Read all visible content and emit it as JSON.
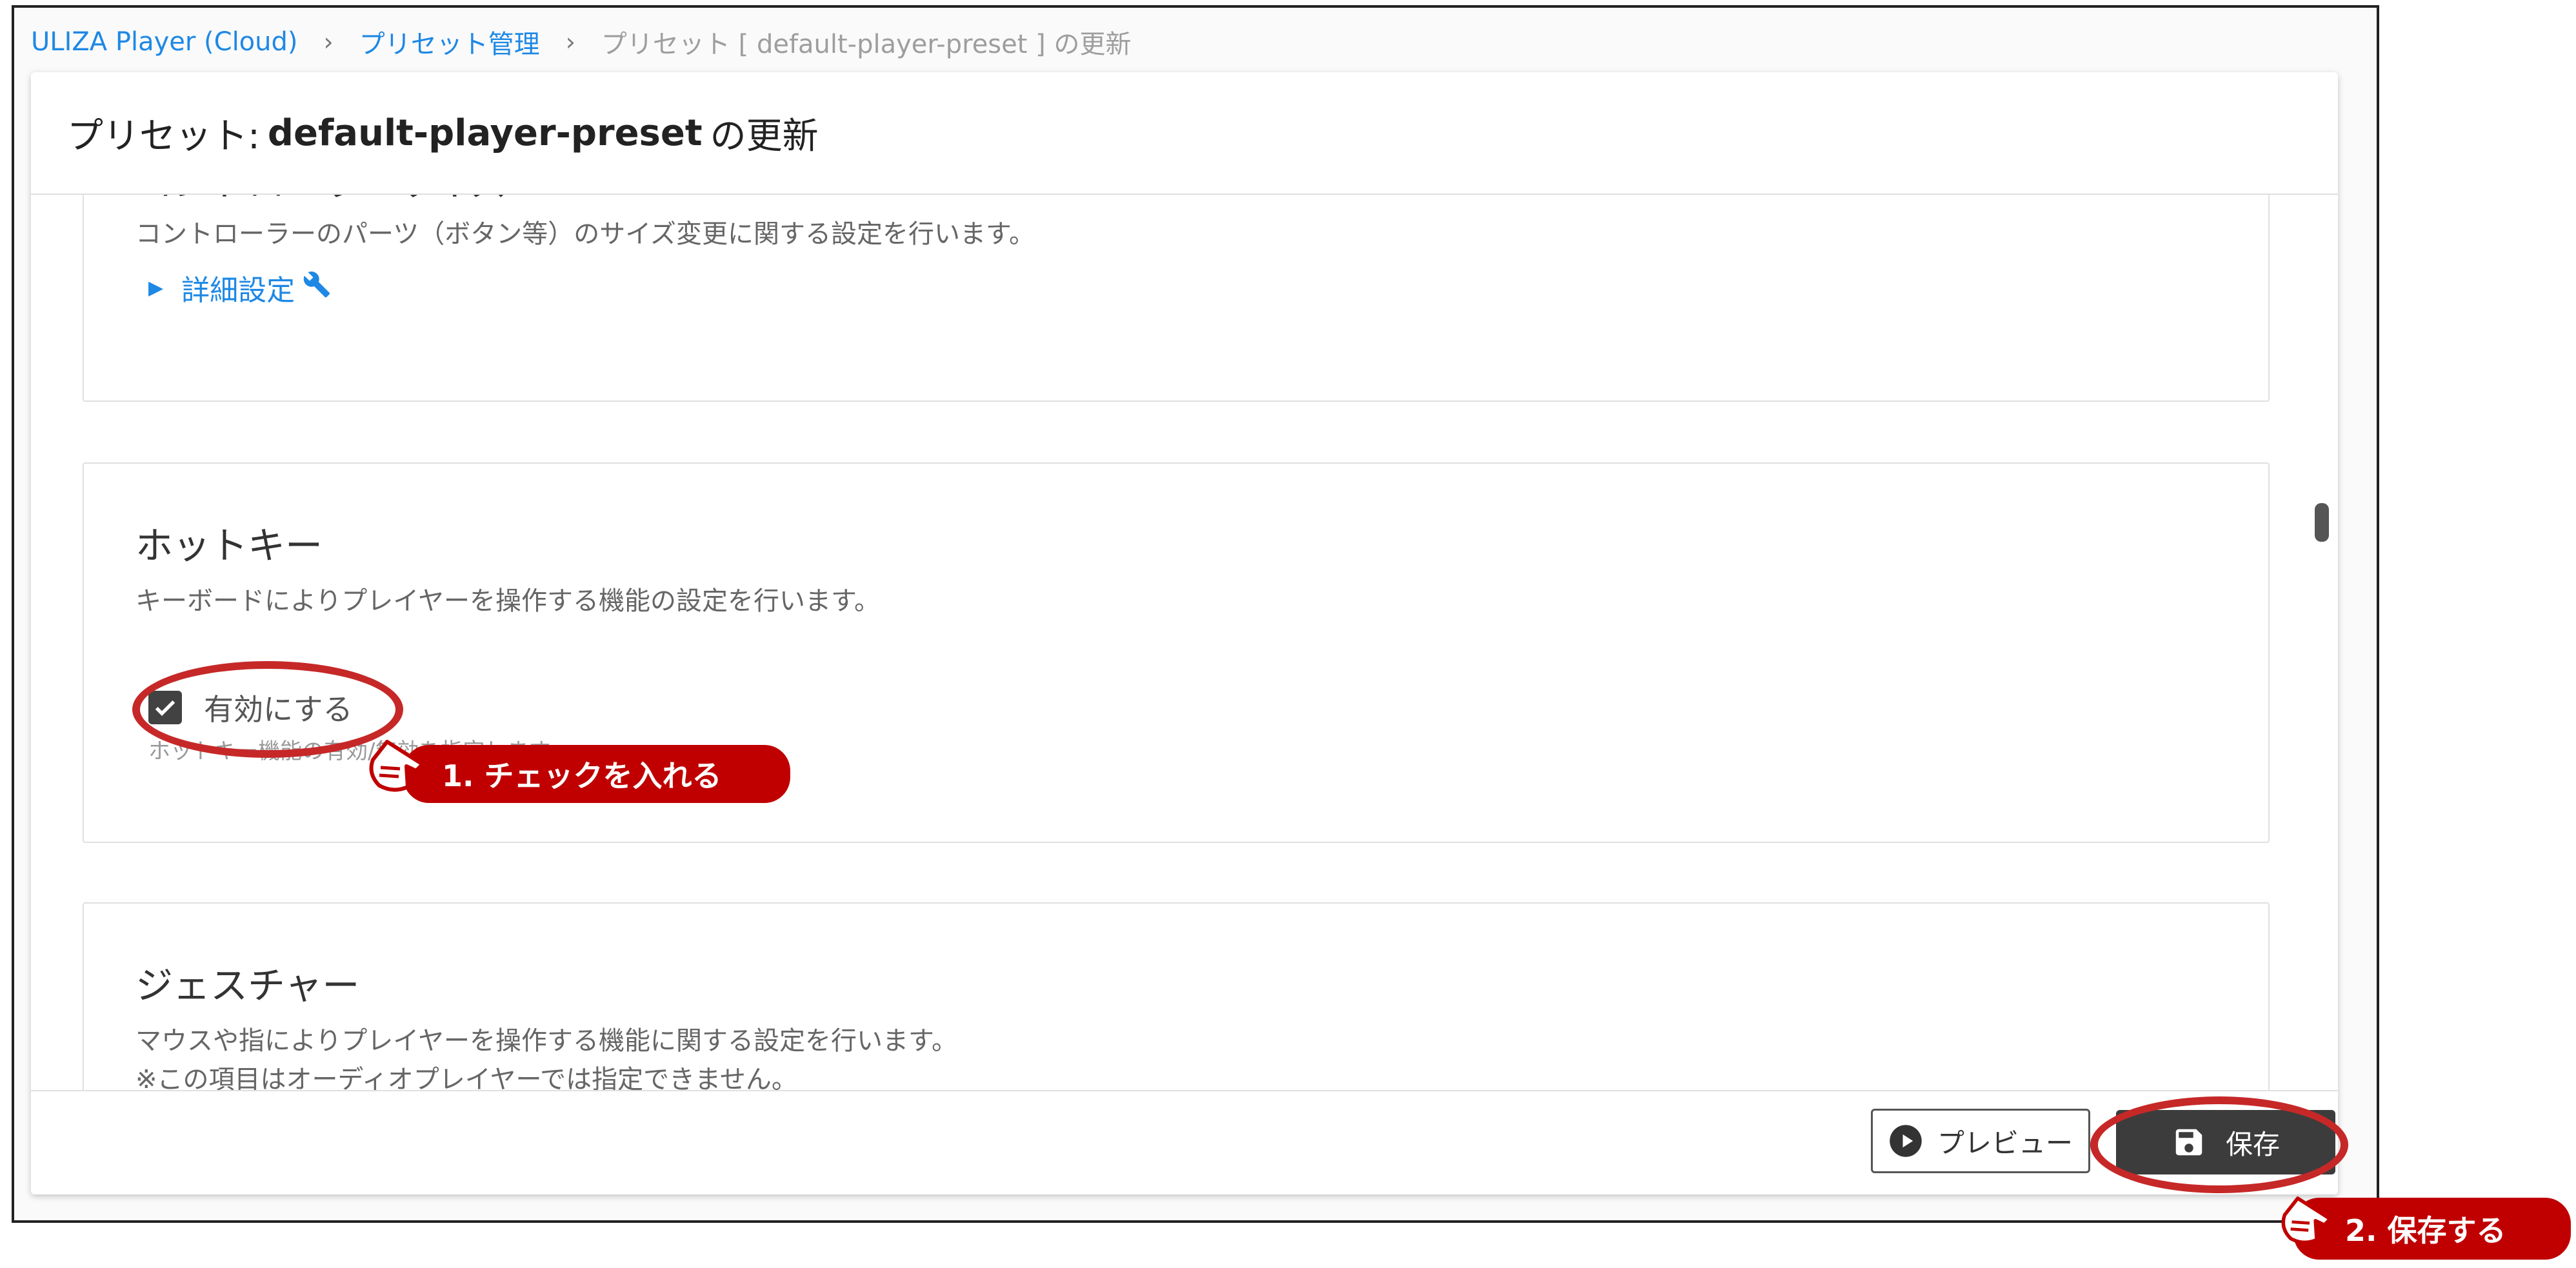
{
  "breadcrumb": {
    "items": [
      "ULIZA Player (Cloud)",
      "プリセット管理"
    ],
    "separator": "›",
    "current": "プリセット [ default-player-preset ] の更新"
  },
  "header": {
    "prefix": "プリセット:",
    "preset_name": "default-player-preset",
    "suffix": "の更新"
  },
  "sections": {
    "controller": {
      "title": "コントローラーサイズ",
      "description": "コントローラーのパーツ（ボタン等）のサイズ変更に関する設定を行います。",
      "detail_link": "詳細設定"
    },
    "hotkey": {
      "title": "ホットキー",
      "description": "キーボードによりプレイヤーを操作する機能の設定を行います。",
      "checkbox_label": "有効にする",
      "checkbox_checked": true,
      "hint": "ホットキー機能の有効/無効を指定します。"
    },
    "gesture": {
      "title": "ジェスチャー",
      "description": "マウスや指によりプレイヤーを操作する機能に関する設定を行います。",
      "note": "※この項目はオーディオプレイヤーでは指定できません。"
    }
  },
  "footer": {
    "preview_label": "プレビュー",
    "save_label": "保存"
  },
  "annotations": {
    "step1": "1. チェックを入れる",
    "step2": "2. 保存する",
    "color": "#c00000"
  },
  "icons": {
    "detail_link": "wrench-icon",
    "preview": "play-circle-icon",
    "save": "floppy-disk-icon",
    "annotation": "pointing-hand-icon"
  }
}
